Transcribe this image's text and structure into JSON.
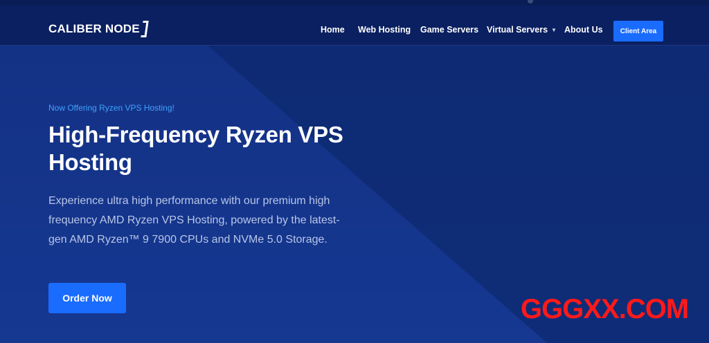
{
  "header": {
    "logo_text": "CALIBER NODE",
    "nav": [
      {
        "label": "Home",
        "has_dropdown": false
      },
      {
        "label": "Web Hosting",
        "has_dropdown": false
      },
      {
        "label": "Game Servers",
        "has_dropdown": false
      },
      {
        "label": "Virtual Servers",
        "has_dropdown": true
      },
      {
        "label": "About Us",
        "has_dropdown": false
      }
    ],
    "client_area_label": "Client Area"
  },
  "hero": {
    "eyebrow": "Now Offering Ryzen VPS Hosting!",
    "headline": "High-Frequency Ryzen VPS Hosting",
    "description": "Experience ultra high performance with our premium high frequency AMD Ryzen VPS Hosting, powered by the latest-gen AMD Ryzen™ 9 7900 CPUs and NVMe 5.0 Storage.",
    "order_label": "Order Now"
  },
  "watermark": "GGGXX.COM",
  "colors": {
    "background": "#0f2a72",
    "header_bg": "#0b2061",
    "accent_blue": "#1a6cff",
    "eyebrow": "#3fa3ff",
    "watermark": "#ff1a1a"
  },
  "icons": {
    "dropdown_caret": "chevron-down-icon",
    "logo_mark": "bracket-logo-mark"
  }
}
